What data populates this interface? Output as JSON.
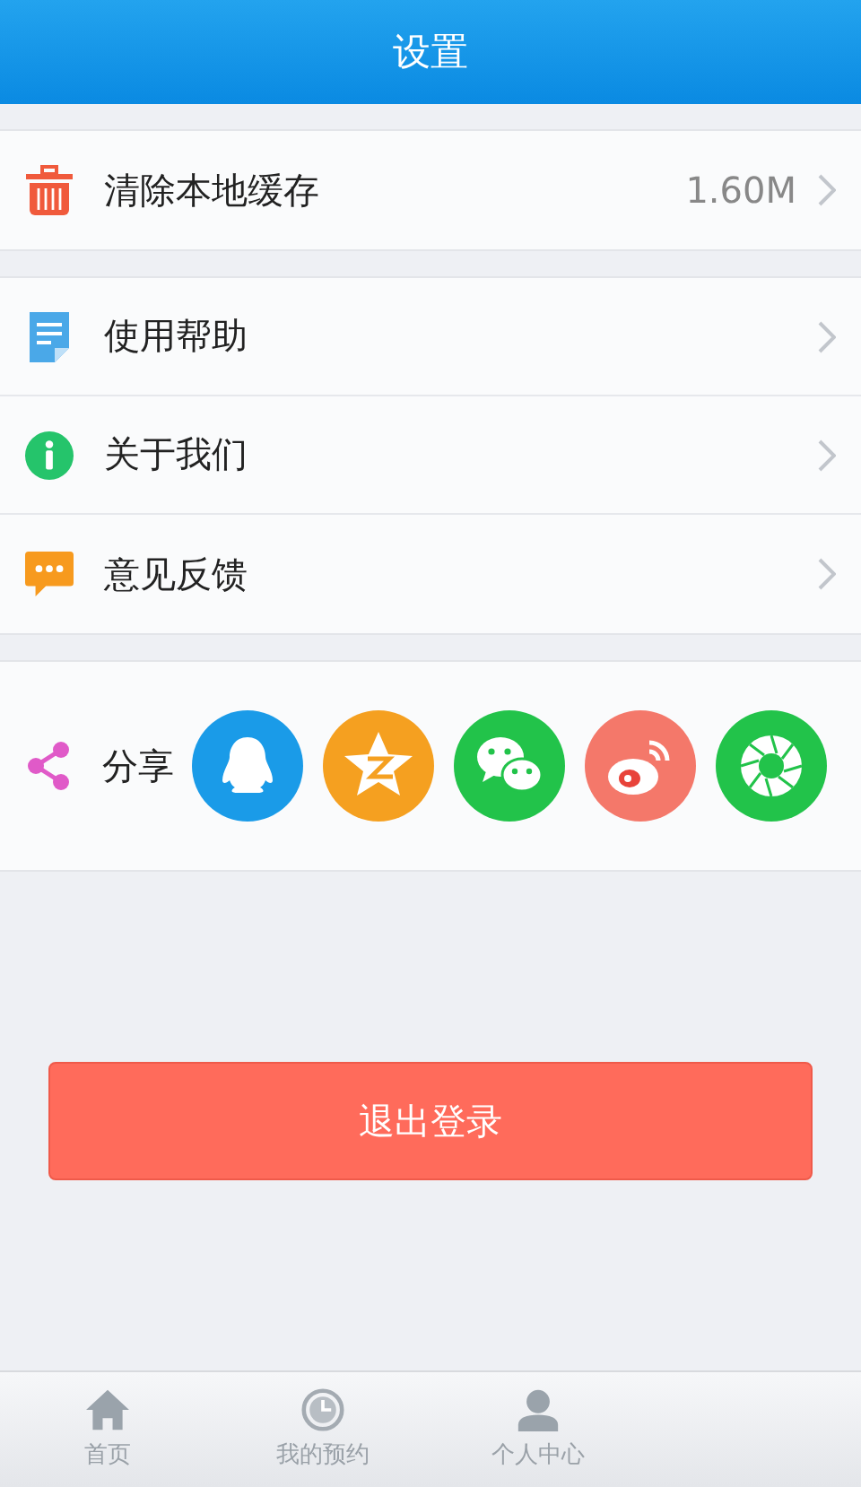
{
  "header": {
    "title": "设置"
  },
  "groups": [
    {
      "rows": [
        {
          "kind": "trash",
          "label": "清除本地缓存",
          "value": "1.60M"
        }
      ]
    },
    {
      "rows": [
        {
          "kind": "doc",
          "label": "使用帮助"
        },
        {
          "kind": "info",
          "label": "关于我们"
        },
        {
          "kind": "chat",
          "label": "意见反馈"
        }
      ]
    }
  ],
  "share": {
    "label": "分享",
    "targets": [
      {
        "kind": "qq"
      },
      {
        "kind": "qzone"
      },
      {
        "kind": "wechat"
      },
      {
        "kind": "weibo"
      },
      {
        "kind": "moments"
      }
    ]
  },
  "logout_button": "退出登录",
  "tab_bar": [
    {
      "kind": "home",
      "label": "首页"
    },
    {
      "kind": "clock",
      "label": "我的预约"
    },
    {
      "kind": "person",
      "label": "个人中心"
    }
  ]
}
